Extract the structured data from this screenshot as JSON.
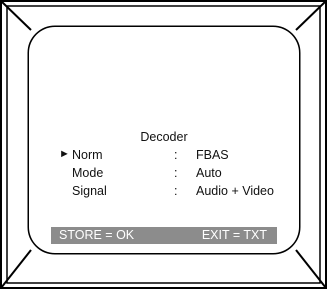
{
  "menu": {
    "title": "Decoder",
    "cursor": "►",
    "rows": [
      {
        "label": "Norm",
        "separator": ":",
        "value": "FBAS",
        "selected": true
      },
      {
        "label": "Mode",
        "separator": ":",
        "value": "Auto",
        "selected": false
      },
      {
        "label": "Signal",
        "separator": ":",
        "value": "Audio + Video",
        "selected": false
      }
    ]
  },
  "status_bar": {
    "store_hint": "STORE = OK",
    "exit_hint": "EXIT = TXT"
  },
  "colors": {
    "frame_line": "#000000",
    "status_bar_bg": "#8c8c8c",
    "status_bar_text": "#ffffff"
  }
}
